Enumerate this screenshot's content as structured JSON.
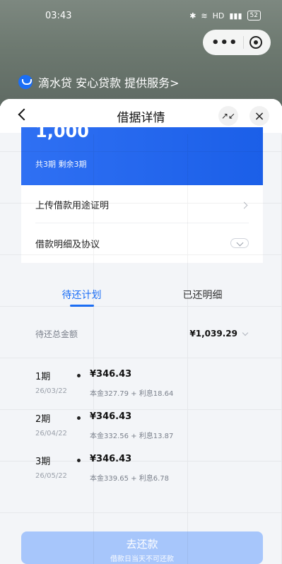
{
  "status_bar": {
    "time": "03:43",
    "battery": "52"
  },
  "provider": {
    "text": "滴水贷 安心贷款 提供服务>"
  },
  "sheet": {
    "title": "借据详情"
  },
  "loan": {
    "amount": "1,000",
    "periods_text": "共3期 剩余3期"
  },
  "links": {
    "purpose_proof": "上传借款用途证明",
    "details_agreement": "借款明细及协议"
  },
  "tabs": [
    {
      "label": "待还计划",
      "active": true
    },
    {
      "label": "已还明细",
      "active": false
    }
  ],
  "total": {
    "label": "待还总金额",
    "value": "¥1,039.29"
  },
  "installments": [
    {
      "period": "1期",
      "date": "26/03/22",
      "amount": "¥346.43",
      "detail": "本金327.79 + 利息18.64"
    },
    {
      "period": "2期",
      "date": "26/04/22",
      "amount": "¥346.43",
      "detail": "本金332.56 + 利息13.87"
    },
    {
      "period": "3期",
      "date": "26/05/22",
      "amount": "¥346.43",
      "detail": "本金339.65 + 利息6.78"
    }
  ],
  "action": {
    "primary": "去还款",
    "secondary": "借款日当天不可还款"
  },
  "colors": {
    "brand_blue": "#1b6ef6",
    "card_blue": "#2f70f3",
    "disabled_button": "#a7c6fb"
  }
}
